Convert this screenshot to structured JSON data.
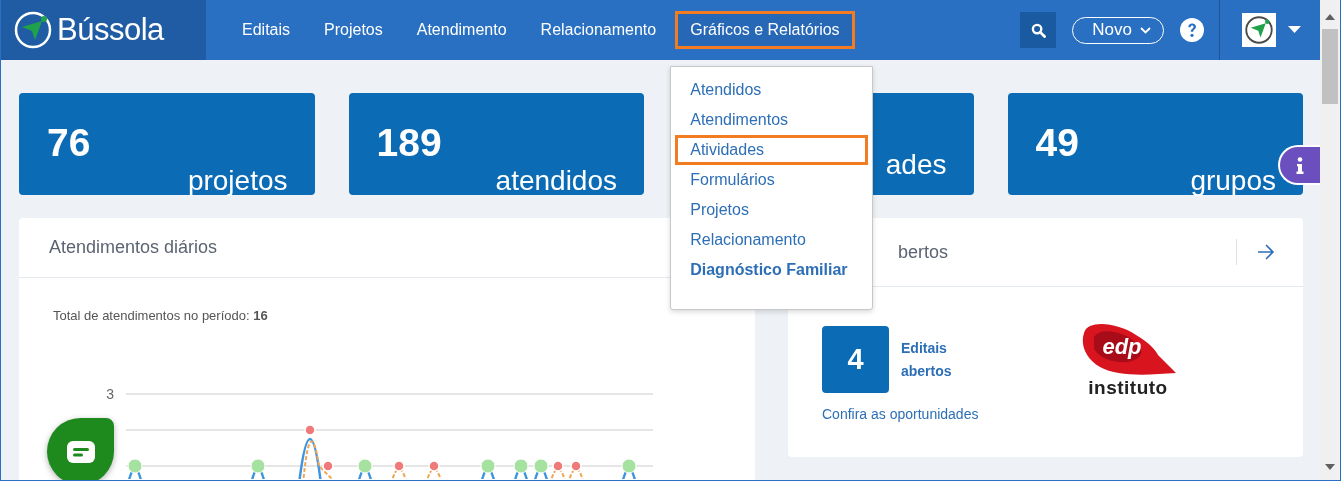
{
  "brand": {
    "name": "Bússola"
  },
  "nav": {
    "items": [
      {
        "label": "Editais",
        "expanded": false,
        "highlighted": false
      },
      {
        "label": "Projetos",
        "expanded": false,
        "highlighted": false
      },
      {
        "label": "Atendimento",
        "expanded": false,
        "highlighted": false
      },
      {
        "label": "Relacionamento",
        "expanded": false,
        "highlighted": false
      },
      {
        "label": "Gráficos e Relatórios",
        "expanded": true,
        "highlighted": true
      }
    ],
    "new_button": "Novo"
  },
  "menu": {
    "items": [
      {
        "label": "Atendidos",
        "kind": "link",
        "highlighted": false
      },
      {
        "label": "Atendimentos",
        "kind": "link",
        "highlighted": false
      },
      {
        "label": "Atividades",
        "kind": "link",
        "highlighted": true
      },
      {
        "label": "Formulários",
        "kind": "link",
        "highlighted": false
      },
      {
        "label": "Projetos",
        "kind": "link",
        "highlighted": false
      },
      {
        "label": "Relacionamento",
        "kind": "link",
        "highlighted": false
      },
      {
        "label": "Diagnóstico Familiar",
        "kind": "featured",
        "highlighted": false
      }
    ]
  },
  "stats": [
    {
      "value": "76",
      "label": "projetos"
    },
    {
      "value": "189",
      "label": "atendidos"
    },
    {
      "label": "ades"
    },
    {
      "value": "49",
      "label": "grupos"
    }
  ],
  "daily_card": {
    "title": "Atendimentos diários",
    "total": "Total de atendimentos no período: **16**",
    "y_tick": "3"
  },
  "editais_card": {
    "title": "bertos",
    "count": "4",
    "count_label": "Editais abertos",
    "link": "Confira as oportunidades",
    "logo": {
      "mark": "edp",
      "caption": "instituto"
    }
  }
}
